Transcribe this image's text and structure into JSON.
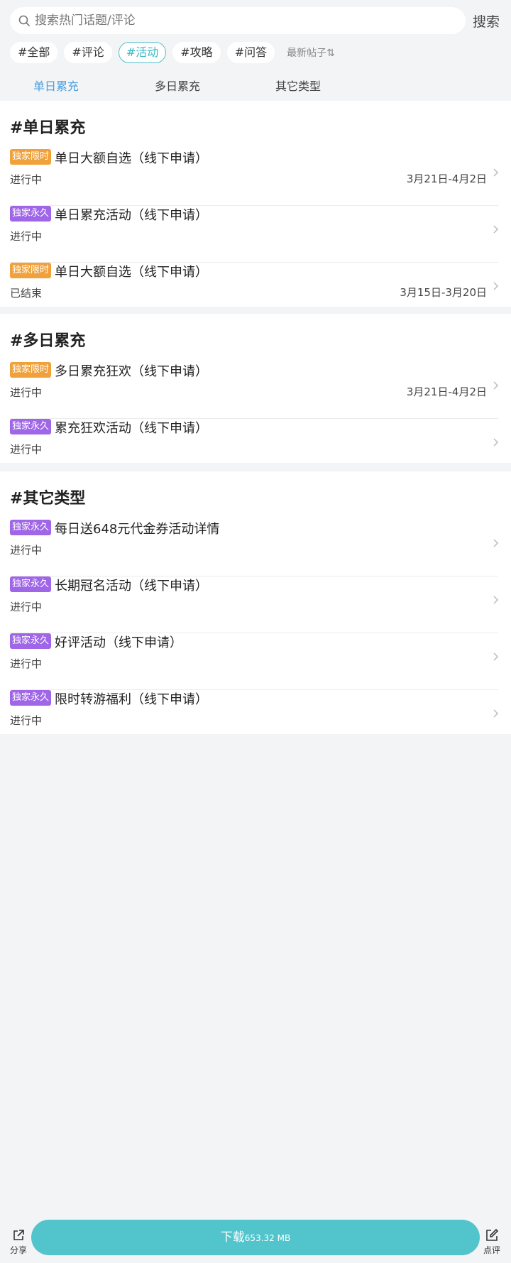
{
  "search": {
    "placeholder": "搜索热门话题/评论",
    "button": "搜索"
  },
  "chips": [
    "#全部",
    "#评论",
    "#活动",
    "#攻略",
    "#问答"
  ],
  "active_chip": "#活动",
  "sort_label": "最新帖子⇅",
  "tabs": [
    "单日累充",
    "多日累充",
    "其它类型"
  ],
  "active_tab": "单日累充",
  "sections": [
    {
      "title": "#单日累充",
      "items": [
        {
          "badge": "独家限时",
          "badge_type": "limited",
          "title": "单日大额自选（线下申请）",
          "status": "进行中",
          "date": "3月21日-4月2日"
        },
        {
          "badge": "独家永久",
          "badge_type": "permanent",
          "title": "单日累充活动（线下申请）",
          "status": "进行中",
          "date": ""
        },
        {
          "badge": "独家限时",
          "badge_type": "limited",
          "title": "单日大额自选（线下申请）",
          "status": "已结束",
          "date": "3月15日-3月20日"
        }
      ]
    },
    {
      "title": "#多日累充",
      "items": [
        {
          "badge": "独家限时",
          "badge_type": "limited",
          "title": "多日累充狂欢（线下申请）",
          "status": "进行中",
          "date": "3月21日-4月2日"
        },
        {
          "badge": "独家永久",
          "badge_type": "permanent",
          "title": "累充狂欢活动（线下申请）",
          "status": "进行中",
          "date": ""
        }
      ]
    },
    {
      "title": "#其它类型",
      "items": [
        {
          "badge": "独家永久",
          "badge_type": "permanent",
          "title": "每日送648元代金券活动详情",
          "status": "进行中",
          "date": ""
        },
        {
          "badge": "独家永久",
          "badge_type": "permanent",
          "title": "长期冠名活动（线下申请）",
          "status": "进行中",
          "date": ""
        },
        {
          "badge": "独家永久",
          "badge_type": "permanent",
          "title": "好评活动（线下申请）",
          "status": "进行中",
          "date": ""
        },
        {
          "badge": "独家永久",
          "badge_type": "permanent",
          "title": "限时转游福利（线下申请）",
          "status": "进行中",
          "date": ""
        }
      ]
    }
  ],
  "bottom": {
    "share_label": "分享",
    "review_label": "点评",
    "download_label": "下载",
    "download_size": "653.32 MB"
  },
  "colors": {
    "accent": "#52c4cc",
    "active_tab": "#4a9fe0",
    "badge_limited": "#f0a13a",
    "badge_permanent": "#a066e8"
  }
}
